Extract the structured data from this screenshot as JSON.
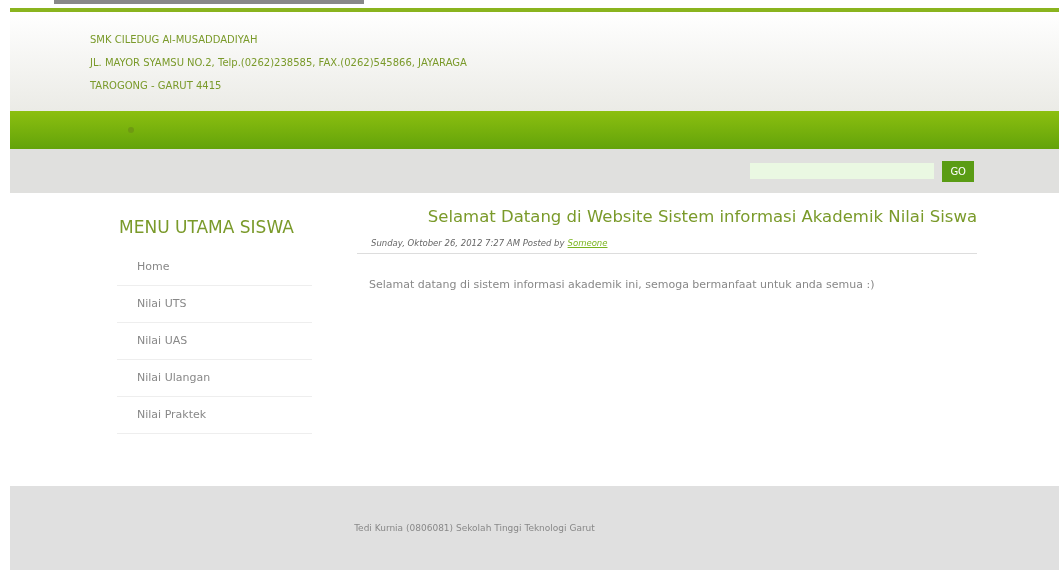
{
  "header": {
    "lines": [
      "SMK CILEDUG Al-MUSADDADIYAH",
      "JL. MAYOR SYAMSU NO.2, Telp.(0262)238585, FAX.(0262)545866, JAYARAGA",
      "TAROGONG - GARUT 4415"
    ]
  },
  "search": {
    "button": "GO"
  },
  "sidebar": {
    "title": "MENU UTAMA SISWA",
    "items": [
      "Home",
      "Nilai UTS",
      "Nilai UAS",
      "Nilai Ulangan",
      "Nilai Praktek"
    ]
  },
  "post": {
    "title": "Selamat Datang di Website Sistem informasi Akademik Nilai Siswa",
    "meta": "Sunday, Oktober 26, 2012 7:27 AM Posted by",
    "author": "Someone",
    "body": "Selamat datang di sistem informasi akademik ini, semoga bermanfaat untuk anda semua :)"
  },
  "footer": "Tedi Kurnia (0806081) Sekolah Tinggi Teknologi Garut"
}
